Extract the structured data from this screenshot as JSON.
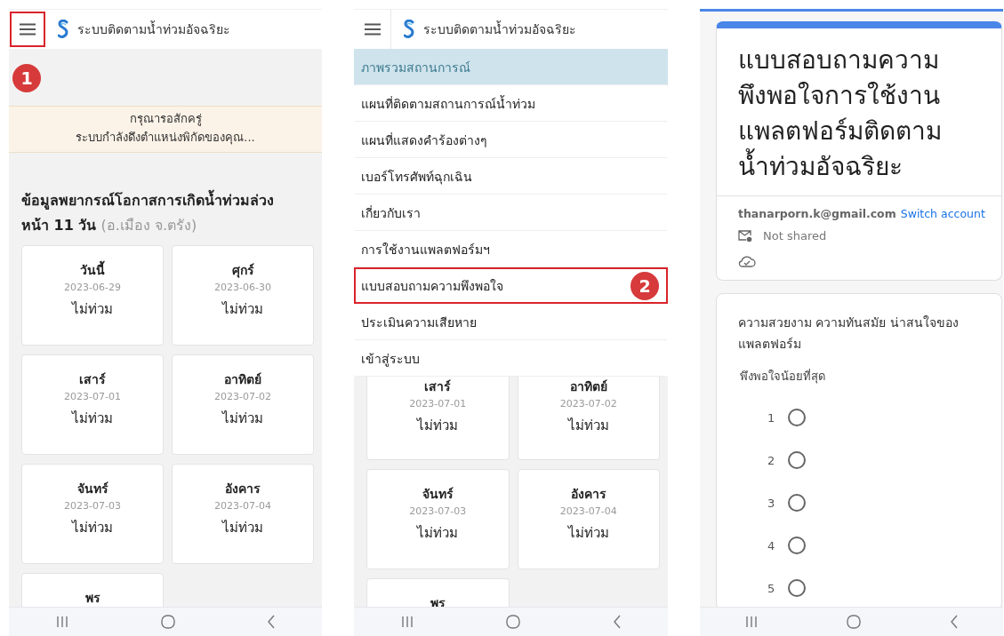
{
  "panels": [
    {
      "kind": "forecast",
      "header": {
        "title": "ระบบติดตามน้ำท่วมอัจฉริยะ",
        "menu_highlighted": true
      },
      "step_badge": "1",
      "notice": [
        "กรุณารอสักครู่",
        "ระบบกำลังดึงตำแหน่งพิกัดของคุณ..."
      ],
      "heading": "**ข้อมูลพยากรณ์โอกาสการเกิดน้ำท่วมล่วงหน้า 11 วัน** (อ.เมือง จ.ตรัง)",
      "cards": [
        {
          "day": "วันนี้",
          "date": "2023-06-29",
          "status": "ไม่ท่วม"
        },
        {
          "day": "ศุกร์",
          "date": "2023-06-30",
          "status": "ไม่ท่วม"
        },
        {
          "day": "เสาร์",
          "date": "2023-07-01",
          "status": "ไม่ท่วม"
        },
        {
          "day": "อาทิตย์",
          "date": "2023-07-02",
          "status": "ไม่ท่วม"
        },
        {
          "day": "จันทร์",
          "date": "2023-07-03",
          "status": "ไม่ท่วม"
        },
        {
          "day": "อังคาร",
          "date": "2023-07-04",
          "status": "ไม่ท่วม"
        },
        {
          "day": "พร"
        }
      ]
    },
    {
      "kind": "menu",
      "header": {
        "title": "ระบบติดตามน้ำท่วมอัจฉริยะ",
        "menu_highlighted": false
      },
      "menu": [
        {
          "label": "ภาพรวมสถานการณ์",
          "selected": true,
          "highlighted": false
        },
        {
          "label": "แผนที่ติดตามสถานการณ์น้ำท่วม",
          "selected": false,
          "highlighted": false
        },
        {
          "label": "แผนที่แสดงคำร้องต่างๆ",
          "selected": false,
          "highlighted": false
        },
        {
          "label": "เบอร์โทรศัพท์ฉุกเฉิน",
          "selected": false,
          "highlighted": false
        },
        {
          "label": "เกี่ยวกับเรา",
          "selected": false,
          "highlighted": false
        },
        {
          "label": "การใช้งานแพลตฟอร์มฯ",
          "selected": false,
          "highlighted": false
        },
        {
          "label": "แบบสอบถามความพึงพอใจ",
          "selected": false,
          "highlighted": true,
          "badge": "2"
        },
        {
          "label": "ประเมินความเสียหาย",
          "selected": false,
          "highlighted": false
        },
        {
          "label": "เข้าสู่ระบบ",
          "selected": false,
          "highlighted": false
        }
      ],
      "cards": [
        {
          "day": "เสาร์",
          "date": "2023-07-01",
          "status": "ไม่ท่วม"
        },
        {
          "day": "อาทิตย์",
          "date": "2023-07-02",
          "status": "ไม่ท่วม"
        },
        {
          "day": "จันทร์",
          "date": "2023-07-03",
          "status": "ไม่ท่วม"
        },
        {
          "day": "อังคาร",
          "date": "2023-07-04",
          "status": "ไม่ท่วม"
        },
        {
          "day": "พร"
        }
      ]
    },
    {
      "kind": "form",
      "title": "แบบสอบถามความพึงพอใจการใช้งานแพลตฟอร์มติดตามน้ำท่วมอัจฉริยะ",
      "account": "thanarporn.k@gmail.com",
      "switch_link": "Switch account",
      "sharing": "Not shared",
      "question": "ความสวยงาม ความทันสมัย น่าสนใจของแพลตฟอร์ม",
      "scale_low_label": "พึงพอใจน้อยที่สุด",
      "options": [
        {
          "label": "1",
          "selected": false
        },
        {
          "label": "2",
          "selected": false
        },
        {
          "label": "3",
          "selected": false
        },
        {
          "label": "4",
          "selected": false
        },
        {
          "label": "5",
          "selected": false
        }
      ]
    }
  ]
}
